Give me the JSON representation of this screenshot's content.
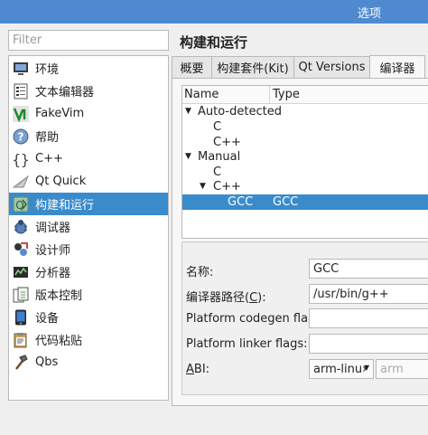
{
  "window": {
    "title": "选项"
  },
  "sidebar": {
    "filter_placeholder": "Filter",
    "items": [
      {
        "label": "环境",
        "icon": "monitor-icon"
      },
      {
        "label": "文本编辑器",
        "icon": "text-document-icon"
      },
      {
        "label": "FakeVim",
        "icon": "fakevim-icon"
      },
      {
        "label": "帮助",
        "icon": "help-icon"
      },
      {
        "label": "C++",
        "icon": "cpp-braces-icon"
      },
      {
        "label": "Qt Quick",
        "icon": "qt-quick-icon"
      },
      {
        "label": "构建和运行",
        "icon": "build-run-icon",
        "selected": true
      },
      {
        "label": "调试器",
        "icon": "debugger-bug-icon"
      },
      {
        "label": "设计师",
        "icon": "designer-icon"
      },
      {
        "label": "分析器",
        "icon": "analyzer-icon"
      },
      {
        "label": "版本控制",
        "icon": "version-control-icon"
      },
      {
        "label": "设备",
        "icon": "device-icon"
      },
      {
        "label": "代码粘贴",
        "icon": "code-paste-icon"
      },
      {
        "label": "Qbs",
        "icon": "qbs-hammer-icon"
      }
    ]
  },
  "main": {
    "title": "构建和运行",
    "tabs": [
      {
        "label": "概要"
      },
      {
        "label": "构建套件(Kit)"
      },
      {
        "label": "Qt Versions"
      },
      {
        "label": "编译器",
        "active": true
      }
    ],
    "tree": {
      "headers": [
        "Name",
        "Type"
      ],
      "rows": [
        {
          "name": "Auto-detected",
          "type": "",
          "expanded": true
        },
        {
          "name": "C",
          "type": ""
        },
        {
          "name": "C++",
          "type": ""
        },
        {
          "name": "Manual",
          "type": "",
          "expanded": true
        },
        {
          "name": "C",
          "type": ""
        },
        {
          "name": "C++",
          "type": "",
          "expanded": true
        },
        {
          "name": "GCC",
          "type": "GCC",
          "selected": true
        }
      ]
    },
    "form": {
      "name_label": "名称:",
      "name_value": "GCC",
      "path_label_pre": "编译器路径(",
      "path_label_key": "C",
      "path_label_post": "):",
      "path_value": "/usr/bin/g++",
      "codegen_label": "Platform codegen flags:",
      "codegen_value": "",
      "linker_label": "Platform linker flags:",
      "linker_value": "",
      "abi_label_key": "A",
      "abi_label_post": "BI:",
      "abi_value": "arm-linu›",
      "abi_secondary": "arm"
    }
  },
  "colors": {
    "titlebar": "#4f8ad1",
    "selection": "#3a8bcb"
  }
}
